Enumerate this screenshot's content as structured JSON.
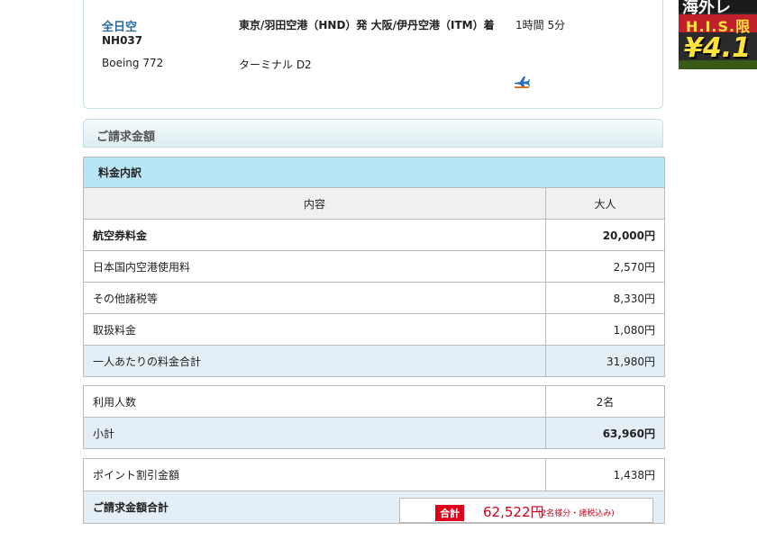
{
  "flight": {
    "airline": "全日空",
    "flight_no": "NH037",
    "route": "東京/羽田空港（HND）発 大阪/伊丹空港（ITM）着",
    "duration": "1時間 5分",
    "aircraft": "Boeing 772",
    "terminal": "ターミナル D2"
  },
  "ad": {
    "top": "海外レ",
    "middle": "H.I.S.限",
    "price": "¥4.1"
  },
  "billing": {
    "section_title": "ご請求金額",
    "breakdown_title": "料金内訳",
    "col_content": "内容",
    "col_adult": "大人",
    "rows": [
      {
        "label": "航空券料金",
        "value": "20,000円"
      },
      {
        "label": "日本国内空港使用料",
        "value": "2,570円"
      },
      {
        "label": "その他諸税等",
        "value": "8,330円"
      },
      {
        "label": "取扱料金",
        "value": "1,080円"
      },
      {
        "label": "一人あたりの料金合計",
        "value": "31,980円"
      }
    ],
    "people_label": "利用人数",
    "people_value": "2名",
    "subtotal_label": "小計",
    "subtotal_value": "63,960円",
    "discount_label": "ポイント割引金額",
    "discount_value": "1,438円",
    "total_label": "ご請求金額合計",
    "total_tag": "合計",
    "total_value": "62,522円",
    "total_note": "(2名様分・諸税込み)"
  },
  "colors": {
    "caption_bg": "#b9e6f7",
    "highlight_row": "#e3eef7",
    "total_red": "#d0001a"
  }
}
